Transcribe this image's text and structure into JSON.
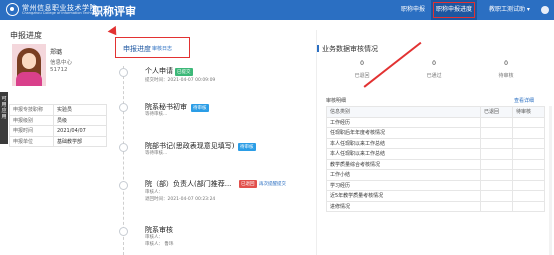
{
  "header": {
    "school_name": "常州信息职业技术学院",
    "school_en": "Changzhou College of Information Technology",
    "app_title": "职称评审",
    "nav": [
      "职称申报",
      "职称申报进度"
    ],
    "user_menu": "教职工测试助 ▾"
  },
  "side_tab": "可用应用",
  "profile": {
    "panel_title": "申报进度",
    "name": "郑璐",
    "dept": "信息中心",
    "id": "51712",
    "rows": [
      {
        "key": "申报专技职称",
        "value": "实验员"
      },
      {
        "key": "申报级别",
        "value": "员级"
      },
      {
        "key": "申报时间",
        "value": "2021/04/07"
      },
      {
        "key": "申报单位",
        "value": "基础教学部"
      }
    ]
  },
  "progress": {
    "title": "申报进度",
    "link": "审核日志",
    "steps": [
      {
        "title": "个人申请",
        "tag": "已提交",
        "tag_color": "#3cb878",
        "sub": "提交时间：2021-04-07 00:09:09",
        "sub2": ""
      },
      {
        "title": "院系秘书初审",
        "tag": "待审核",
        "tag_color": "#2b9de6",
        "sub": "审核人：",
        "sub2": "等待审核..."
      },
      {
        "title": "院部书记(思政表现意见填写)",
        "tag": "待审核",
        "tag_color": "#2b9de6",
        "sub": "审核人：",
        "sub2": "等待审核..."
      },
      {
        "title": "院（部）负责人(部门推荐...",
        "tag": "已退回",
        "tag_color": "#e2504c",
        "sub": "审核人：",
        "sub2": "退回时间：2021-04-07 00:23:24",
        "reminder": "再次提醒提交"
      },
      {
        "title": "院系审核",
        "tag": "",
        "tag_color": "",
        "sub": "审核人：",
        "sub2": "审核人：   鲁玮"
      }
    ]
  },
  "stats": {
    "title": "业务数据审核情况",
    "boxes": [
      {
        "value": "0",
        "label": "已退回"
      },
      {
        "value": "0",
        "label": "已通过"
      },
      {
        "value": "0",
        "label": "待审核"
      }
    ],
    "detail_head": "审核明细",
    "detail_link": "查看详细",
    "columns": [
      "信息类别",
      "已退回",
      "待审核"
    ],
    "rows": [
      [
        "工作经历",
        "",
        ""
      ],
      [
        "任现职后年年度考核情况",
        "",
        ""
      ],
      [
        "本人任现职以来工作总结",
        "",
        ""
      ],
      [
        "本人任现职以来工作总结",
        "",
        ""
      ],
      [
        "教学质量综合考核情况",
        "",
        ""
      ],
      [
        "工作小结",
        "",
        ""
      ],
      [
        "学习经历",
        "",
        ""
      ],
      [
        "近5年教学质量考核情况",
        "",
        ""
      ],
      [
        "进修情况",
        "",
        ""
      ]
    ]
  },
  "colors": {
    "brand": "#2b6fc2",
    "highlight": "#e23232"
  }
}
